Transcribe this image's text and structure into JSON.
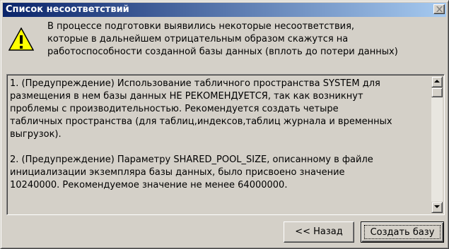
{
  "window": {
    "title": "Список несоответствий"
  },
  "message": {
    "lines": [
      "В процессе подготовки выявились некоторые несоответствия,",
      "которые в дальнейшем отрицательным образом скажутся на",
      "работоспособности созданной базы данных (вплоть до потери данных)"
    ]
  },
  "details": {
    "lines": [
      "1. (Предупреждение) Использование табличного пространства SYSTEM для",
      "размещения в нем базы данных НЕ РЕКОМЕНДУЕТСЯ, так как возникнут",
      "проблемы с производительностью. Рекомендуется создать четыре",
      "табличных пространства (для таблиц,индексов,таблиц журнала и временных",
      "выгрузок).",
      "",
      "2. (Предупреждение) Параметру SHARED_POOL_SIZE, описанному в файле",
      "инициализации экземпляра базы данных, было присвоено значение",
      "10240000. Рекомендуемое значение не менее  64000000.",
      ""
    ]
  },
  "buttons": {
    "back": "<< Назад",
    "create": "Создать базу"
  },
  "icons": {
    "warning": "warning-icon",
    "close": "close-icon",
    "scroll_up": "scroll-up-arrow-icon",
    "scroll_down": "scroll-down-arrow-icon"
  },
  "colors": {
    "titlebar_start": "#0a246a",
    "titlebar_end": "#a6caf0",
    "face": "#d4d0c8",
    "warning_yellow": "#ffff00"
  }
}
